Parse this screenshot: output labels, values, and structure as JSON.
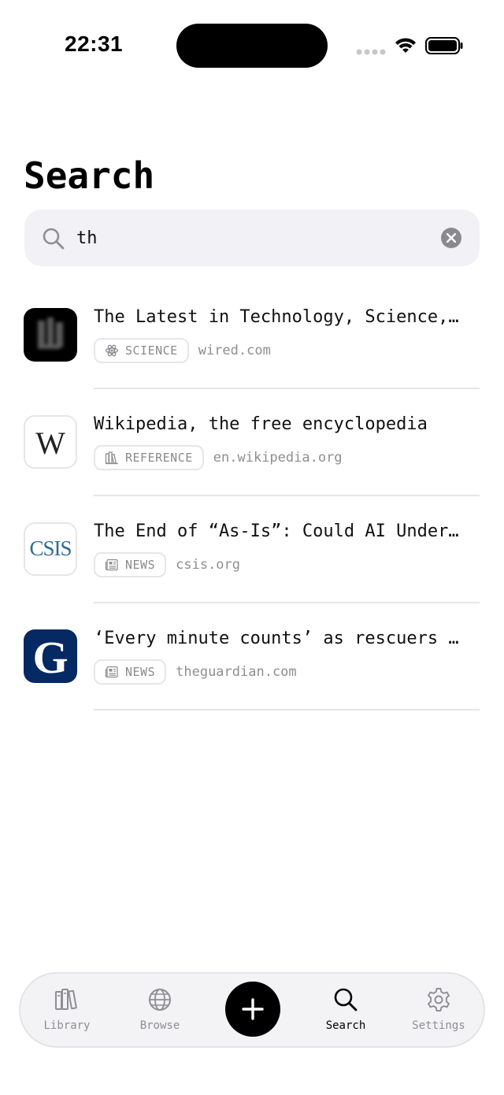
{
  "status_bar": {
    "time": "22:31"
  },
  "page": {
    "title": "Search"
  },
  "search": {
    "value": "th"
  },
  "results": [
    {
      "title": "The Latest in Technology, Science, Culture and Business",
      "tag": "SCIENCE",
      "tag_icon": "atom-icon",
      "domain": "wired.com",
      "favicon": "wired-logo"
    },
    {
      "title": "Wikipedia, the free encyclopedia",
      "tag": "REFERENCE",
      "tag_icon": "books-icon",
      "domain": "en.wikipedia.org",
      "favicon": "wikipedia-logo",
      "favicon_text": "W"
    },
    {
      "title": "The End of “As-Is”: Could AI Undermine Software Liability",
      "tag": "NEWS",
      "tag_icon": "newspaper-icon",
      "domain": "csis.org",
      "favicon": "csis-logo",
      "favicon_text": "CSIS"
    },
    {
      "title": "‘Every minute counts’ as rescuers search for survivors",
      "tag": "NEWS",
      "tag_icon": "newspaper-icon",
      "domain": "theguardian.com",
      "favicon": "guardian-logo",
      "favicon_text": "G"
    }
  ],
  "tab_bar": {
    "tabs": [
      {
        "label": "Library",
        "icon": "books-icon",
        "active": false
      },
      {
        "label": "Browse",
        "icon": "globe-icon",
        "active": false
      },
      {
        "label": "Search",
        "icon": "search-icon",
        "active": true
      },
      {
        "label": "Settings",
        "icon": "gear-icon",
        "active": false
      }
    ],
    "fab_icon": "plus-icon"
  },
  "colors": {
    "accent": "#000000",
    "muted": "#8e8e93",
    "field_bg": "#f1f1f6",
    "guardian_blue": "#052962",
    "csis_blue": "#2e6c96"
  }
}
